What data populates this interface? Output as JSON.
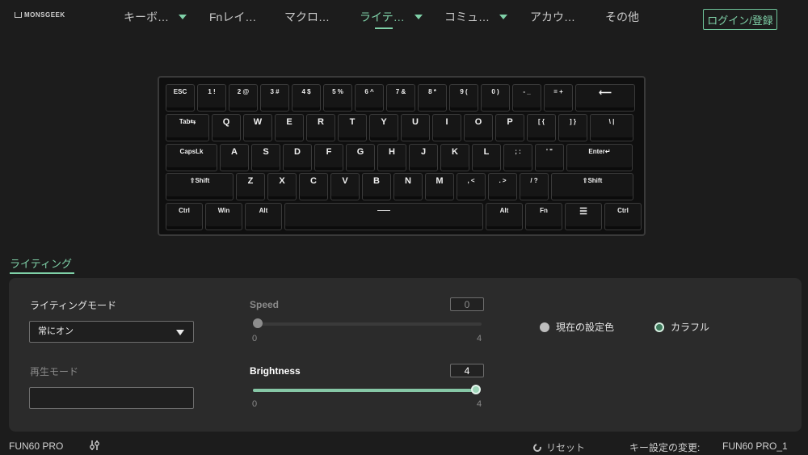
{
  "brand": {
    "logo_text": "MONSGEEK"
  },
  "nav": {
    "items": [
      {
        "label": "キーボ…",
        "dropdown": true
      },
      {
        "label": "Fnレイ…",
        "dropdown": false
      },
      {
        "label": "マクロ…",
        "dropdown": false
      },
      {
        "label": "ライテ…",
        "dropdown": true,
        "active": true
      },
      {
        "label": "コミュ…",
        "dropdown": true
      },
      {
        "label": "アカウ…",
        "dropdown": false
      },
      {
        "label": "その他",
        "dropdown": false
      }
    ],
    "login_label": "ログイン/登録"
  },
  "keyboard": {
    "rows": [
      [
        "ESC",
        "1 !",
        "2 @",
        "3 #",
        "4 $",
        "5 %",
        "6 ^",
        "7 &",
        "8 *",
        "9 (",
        "0 )",
        "- _",
        "= +",
        "⟵"
      ],
      [
        "Tab⇆",
        "Q",
        "W",
        "E",
        "R",
        "T",
        "Y",
        "U",
        "I",
        "O",
        "P",
        "[ {",
        "] }",
        "\\ |"
      ],
      [
        "CapsLk",
        "A",
        "S",
        "D",
        "F",
        "G",
        "H",
        "J",
        "K",
        "L",
        "; :",
        "' \"",
        "Enter↵"
      ],
      [
        "⇧Shift",
        "Z",
        "X",
        "C",
        "V",
        "B",
        "N",
        "M",
        ", <",
        ". >",
        "/ ?",
        "⇧Shift"
      ],
      [
        "Ctrl",
        "Win",
        "Alt",
        "——",
        "Alt",
        "Fn",
        "☰",
        "Ctrl"
      ]
    ]
  },
  "lighting": {
    "section_title": "ライティング",
    "mode_label": "ライティングモード",
    "mode_value": "常にオン",
    "playback_label": "再生モード",
    "playback_value": "",
    "speed": {
      "label": "Speed",
      "value": "0",
      "min": "0",
      "max": "4",
      "fraction": 0
    },
    "brightness": {
      "label": "Brightness",
      "value": "4",
      "min": "0",
      "max": "4",
      "fraction": 1
    },
    "color_options": [
      {
        "label": "現在の設定色",
        "selected": false
      },
      {
        "label": "カラフル",
        "selected": true
      }
    ]
  },
  "footer": {
    "device_name": "FUN60 PRO",
    "reset_label": "リセット",
    "keyset_label": "キー設定の変更:",
    "profile_name": "FUN60 PRO_1"
  },
  "colors": {
    "accent": "#7fd1a8",
    "background": "#1c1c1c",
    "panel": "#2b2b2b"
  }
}
